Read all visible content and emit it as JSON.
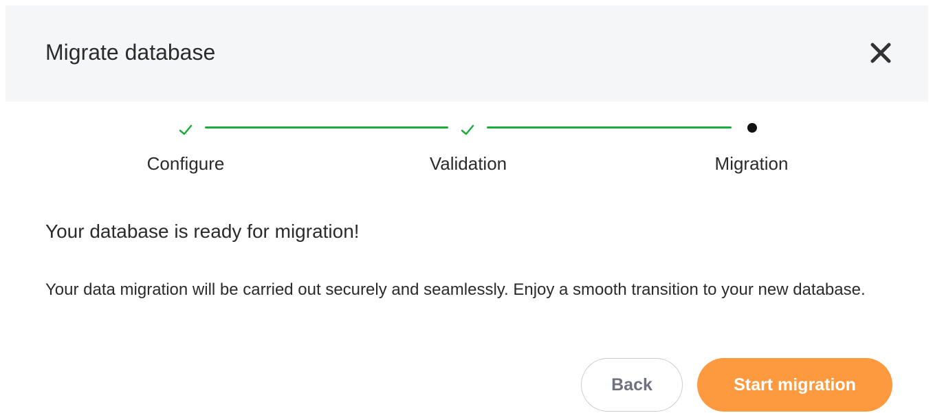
{
  "dialog": {
    "title": "Migrate database",
    "close_icon": "close-icon"
  },
  "stepper": {
    "steps": [
      {
        "label": "Configure",
        "status": "completed",
        "icon": "check-icon"
      },
      {
        "label": "Validation",
        "status": "completed",
        "icon": "check-icon"
      },
      {
        "label": "Migration",
        "status": "current",
        "icon": "dot-icon"
      }
    ],
    "completed_color": "#1aac3c",
    "current_color": "#111111"
  },
  "content": {
    "heading": "Your database is ready for migration!",
    "description": "Your data migration will be carried out securely and seamlessly. Enjoy a smooth transition to your new database."
  },
  "actions": {
    "back_label": "Back",
    "start_label": "Start migration",
    "primary_color": "#fd9a3f"
  }
}
